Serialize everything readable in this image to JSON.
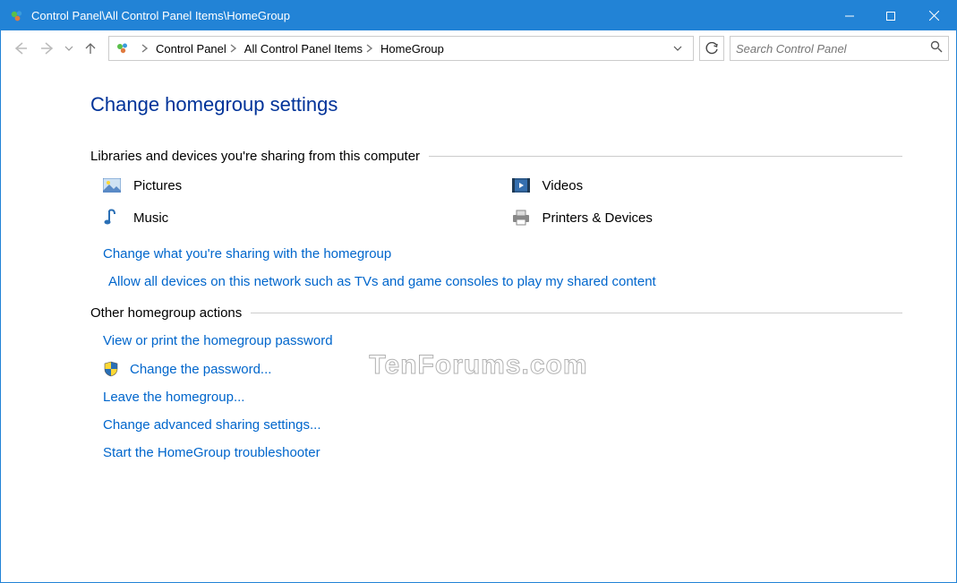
{
  "window": {
    "title": "Control Panel\\All Control Panel Items\\HomeGroup"
  },
  "breadcrumb": {
    "items": [
      {
        "label": "Control Panel"
      },
      {
        "label": "All Control Panel Items"
      },
      {
        "label": "HomeGroup"
      }
    ]
  },
  "search": {
    "placeholder": "Search Control Panel"
  },
  "page": {
    "heading": "Change homegroup settings",
    "section1_label": "Libraries and devices you're sharing from this computer",
    "shares": {
      "pictures": "Pictures",
      "videos": "Videos",
      "music": "Music",
      "printers": "Printers & Devices"
    },
    "link_change_sharing": "Change what you're sharing with the homegroup",
    "link_allow_devices": "Allow all devices on this network such as TVs and game consoles to play my shared content",
    "section2_label": "Other homegroup actions",
    "link_view_password": "View or print the homegroup password",
    "link_change_password": "Change the password...",
    "link_leave": "Leave the homegroup...",
    "link_advanced": "Change advanced sharing settings...",
    "link_troubleshoot": "Start the HomeGroup troubleshooter"
  },
  "watermark": "TenForums.com"
}
